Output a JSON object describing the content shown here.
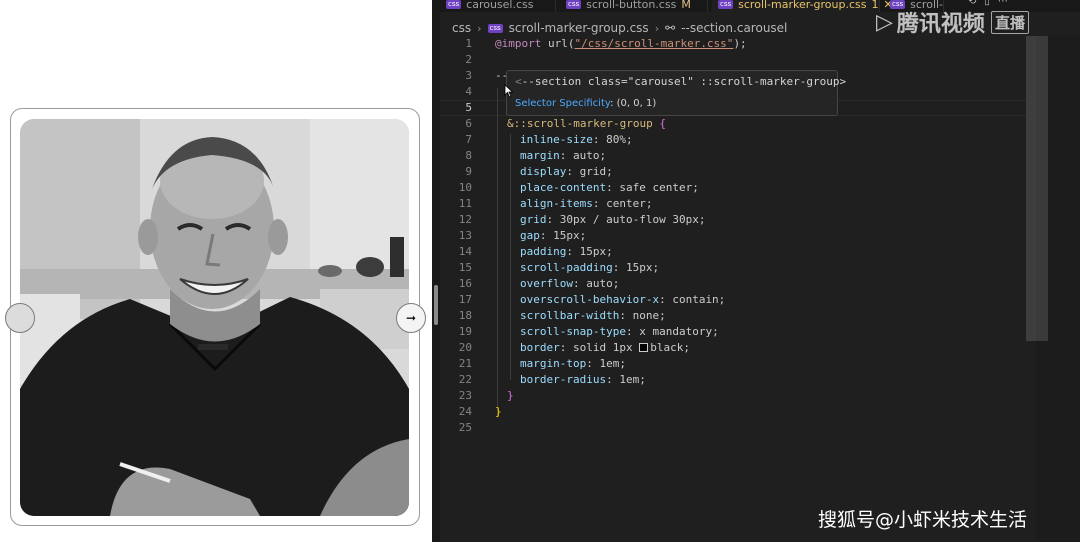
{
  "preview": {
    "prev_button_label": "",
    "next_button_label": "➞"
  },
  "tabs": [
    {
      "label": "carousel.css",
      "badge": "css",
      "modified": ""
    },
    {
      "label": "scroll-button.css",
      "badge": "css",
      "modified": "M"
    },
    {
      "label": "scroll-marker-group.css",
      "badge": "css",
      "modified": "1"
    },
    {
      "label": "scroll-",
      "badge": "css",
      "modified": ""
    }
  ],
  "breadcrumb": {
    "folder": "css",
    "file": "scroll-marker-group.css",
    "file_badge": "css",
    "symbol": "--section.carousel"
  },
  "hover": {
    "selector_open": "<",
    "selector": "--section class=\"carousel\" ::scroll-marker-group>",
    "specificity_label": "Selector Specificity",
    "specificity_value": ": (0, 0, 1)"
  },
  "code": {
    "import_kw": "@import",
    "import_fn": " url(",
    "import_str": "\"/css/scroll-marker.css\"",
    "import_end": ");",
    "line3_fragment": "--",
    "nested_selector": "&::scroll-marker-group",
    "nested_open": " {",
    "close_inner": "}",
    "close_outer": "}",
    "declarations": [
      {
        "prop": "inline-size",
        "value": " 80%;"
      },
      {
        "prop": "margin",
        "value": " auto;"
      },
      {
        "prop": "display",
        "value": " grid;"
      },
      {
        "prop": "place-content",
        "value": " safe center;"
      },
      {
        "prop": "align-items",
        "value": " center;"
      },
      {
        "prop": "grid",
        "value": " 30px / auto-flow 30px;"
      },
      {
        "prop": "gap",
        "value": " 15px;"
      },
      {
        "prop": "padding",
        "value": " 15px;"
      },
      {
        "prop": "scroll-padding",
        "value": " 15px;"
      },
      {
        "prop": "overflow",
        "value": " auto;"
      },
      {
        "prop": "overscroll-behavior-x",
        "value": " contain;"
      },
      {
        "prop": "scrollbar-width",
        "value": " none;"
      },
      {
        "prop": "scroll-snap-type",
        "value": " x mandatory;"
      },
      {
        "prop": "border",
        "value_pre": " solid 1px ",
        "value_post": "black;"
      },
      {
        "prop": "margin-top",
        "value": " 1em;"
      },
      {
        "prop": "border-radius",
        "value": " 1em;"
      }
    ],
    "line_numbers": [
      "1",
      "2",
      "3",
      "4",
      "5",
      "6",
      "7",
      "8",
      "9",
      "10",
      "11",
      "12",
      "13",
      "14",
      "15",
      "16",
      "17",
      "18",
      "19",
      "20",
      "21",
      "22",
      "23",
      "24",
      "25"
    ]
  },
  "watermarks": {
    "top_brand": "腾讯视频",
    "top_live": "直播",
    "bottom": "搜狐号@小虾米技术生活"
  },
  "colors": {
    "editor_bg": "#1f1f1f",
    "property": "#9cdcfe",
    "selector": "#d7ba7d",
    "string": "#ce9178",
    "at_rule": "#c586c0",
    "link": "#4daafc"
  }
}
